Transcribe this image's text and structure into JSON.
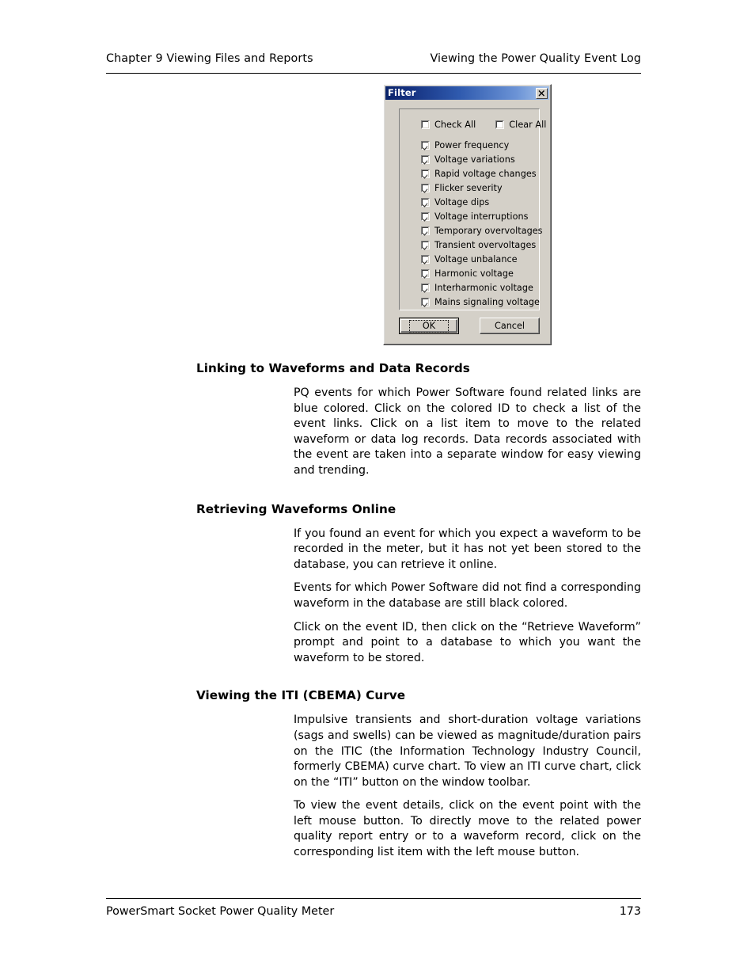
{
  "page": {
    "header_left": "Chapter 9 Viewing Files and Reports",
    "header_right": "Viewing the Power Quality Event Log",
    "footer_left": "PowerSmart Socket Power Quality Meter",
    "footer_page_number": "173"
  },
  "dialog": {
    "title": "Filter",
    "close_label": "×",
    "top_checks": [
      {
        "label": "Check All",
        "checked": false
      },
      {
        "label": "Clear All",
        "checked": false
      }
    ],
    "items": [
      {
        "label": "Power frequency",
        "checked": true
      },
      {
        "label": "Voltage variations",
        "checked": true
      },
      {
        "label": "Rapid voltage changes",
        "checked": true
      },
      {
        "label": "Flicker severity",
        "checked": true
      },
      {
        "label": "Voltage dips",
        "checked": true
      },
      {
        "label": "Voltage interruptions",
        "checked": true
      },
      {
        "label": "Temporary overvoltages",
        "checked": true
      },
      {
        "label": "Transient overvoltages",
        "checked": true
      },
      {
        "label": "Voltage unbalance",
        "checked": true
      },
      {
        "label": "Harmonic voltage",
        "checked": true
      },
      {
        "label": "Interharmonic voltage",
        "checked": true
      },
      {
        "label": "Mains signaling voltage",
        "checked": true
      }
    ],
    "buttons": {
      "ok": "OK",
      "cancel": "Cancel"
    },
    "colors": {
      "titlebar_start": "#0a246a",
      "titlebar_end": "#a6c3ea",
      "face": "#d4d0c8"
    }
  },
  "sections": [
    {
      "heading": "Linking to Waveforms and Data Records",
      "paragraphs": [
        "PQ events for which Power Software found related links are blue colored. Click on the colored ID to check a list of the event links. Click on a list item to move to the related waveform or data log records. Data records associated with the event are taken into a separate window for easy viewing and trending."
      ]
    },
    {
      "heading": "Retrieving Waveforms Online",
      "paragraphs": [
        "If you found an event for which you expect a waveform to be recorded in the meter, but it has not yet been stored to the database, you can retrieve it online.",
        "Events for which Power Software did not find a corresponding waveform in the database are still black colored.",
        "Click on the event ID, then click on the “Retrieve Waveform” prompt and point to a database to which you want the waveform to be stored."
      ]
    },
    {
      "heading": "Viewing the ITI (CBEMA) Curve",
      "paragraphs": [
        "Impulsive transients and short-duration voltage variations (sags and swells) can be viewed as magnitude/duration pairs on the ITIC (the Information Technology Industry Council, formerly CBEMA) curve chart. To view an ITI curve chart, click on the “ITI” button on the window toolbar.",
        "To view the event details, click on the event point with the left mouse button. To directly move to the related power quality report entry or to a waveform record, click on the corresponding list item with the left mouse button."
      ]
    }
  ]
}
